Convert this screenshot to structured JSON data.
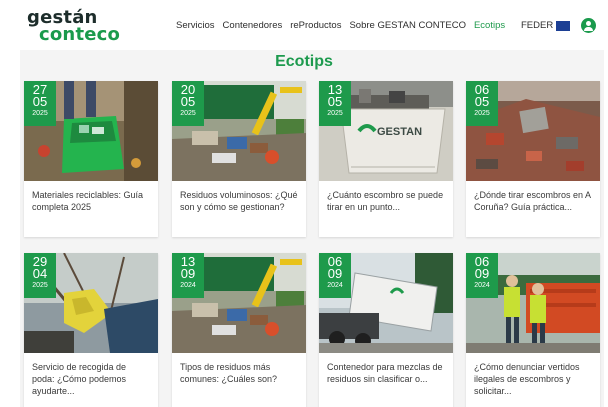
{
  "brand": {
    "line1": "gestán",
    "line2": "conteco"
  },
  "nav": [
    {
      "label": "Servicios",
      "active": false
    },
    {
      "label": "Contenedores",
      "active": false
    },
    {
      "label": "reProductos",
      "active": false
    },
    {
      "label": "Sobre GESTAN CONTECO",
      "active": false
    },
    {
      "label": "Ecotips",
      "active": true
    }
  ],
  "feder": "FEDER",
  "page_title": "Ecotips",
  "colors": {
    "accent": "#1e9a4b",
    "text": "#3a3a3a",
    "background": "#f4f4f4"
  },
  "cards": [
    {
      "day": "27",
      "month": "05",
      "year": "2025",
      "title": "Materiales reciclables: Guía completa 2025",
      "image": "green-bag-recycling"
    },
    {
      "day": "20",
      "month": "05",
      "year": "2025",
      "title": "Residuos voluminosos: ¿Qué son y cómo se gestionan?",
      "image": "bulky-waste-excavator"
    },
    {
      "day": "13",
      "month": "05",
      "year": "2025",
      "title": "¿Cuánto escombro se puede tirar en un punto...",
      "image": "gestan-container",
      "container_text": "GESTAN"
    },
    {
      "day": "06",
      "month": "05",
      "year": "2025",
      "title": "¿Dónde tirar escombros en A Coruña? Guía práctica...",
      "image": "rubble-pile"
    },
    {
      "day": "29",
      "month": "04",
      "year": "2025",
      "title": "Servicio de recogida de poda: ¿Cómo podemos ayudarte...",
      "image": "pruning-gloves"
    },
    {
      "day": "13",
      "month": "09",
      "year": "2024",
      "title": "Tipos de residuos más comunes: ¿Cuáles son?",
      "image": "bulky-waste-excavator"
    },
    {
      "day": "06",
      "month": "09",
      "year": "2024",
      "title": "Contenedor para mezclas de residuos sin clasificar o...",
      "image": "truck-container"
    },
    {
      "day": "06",
      "month": "09",
      "year": "2024",
      "title": "¿Cómo denunciar vertidos ilegales de escombros y solicitar...",
      "image": "workers-containers"
    }
  ]
}
